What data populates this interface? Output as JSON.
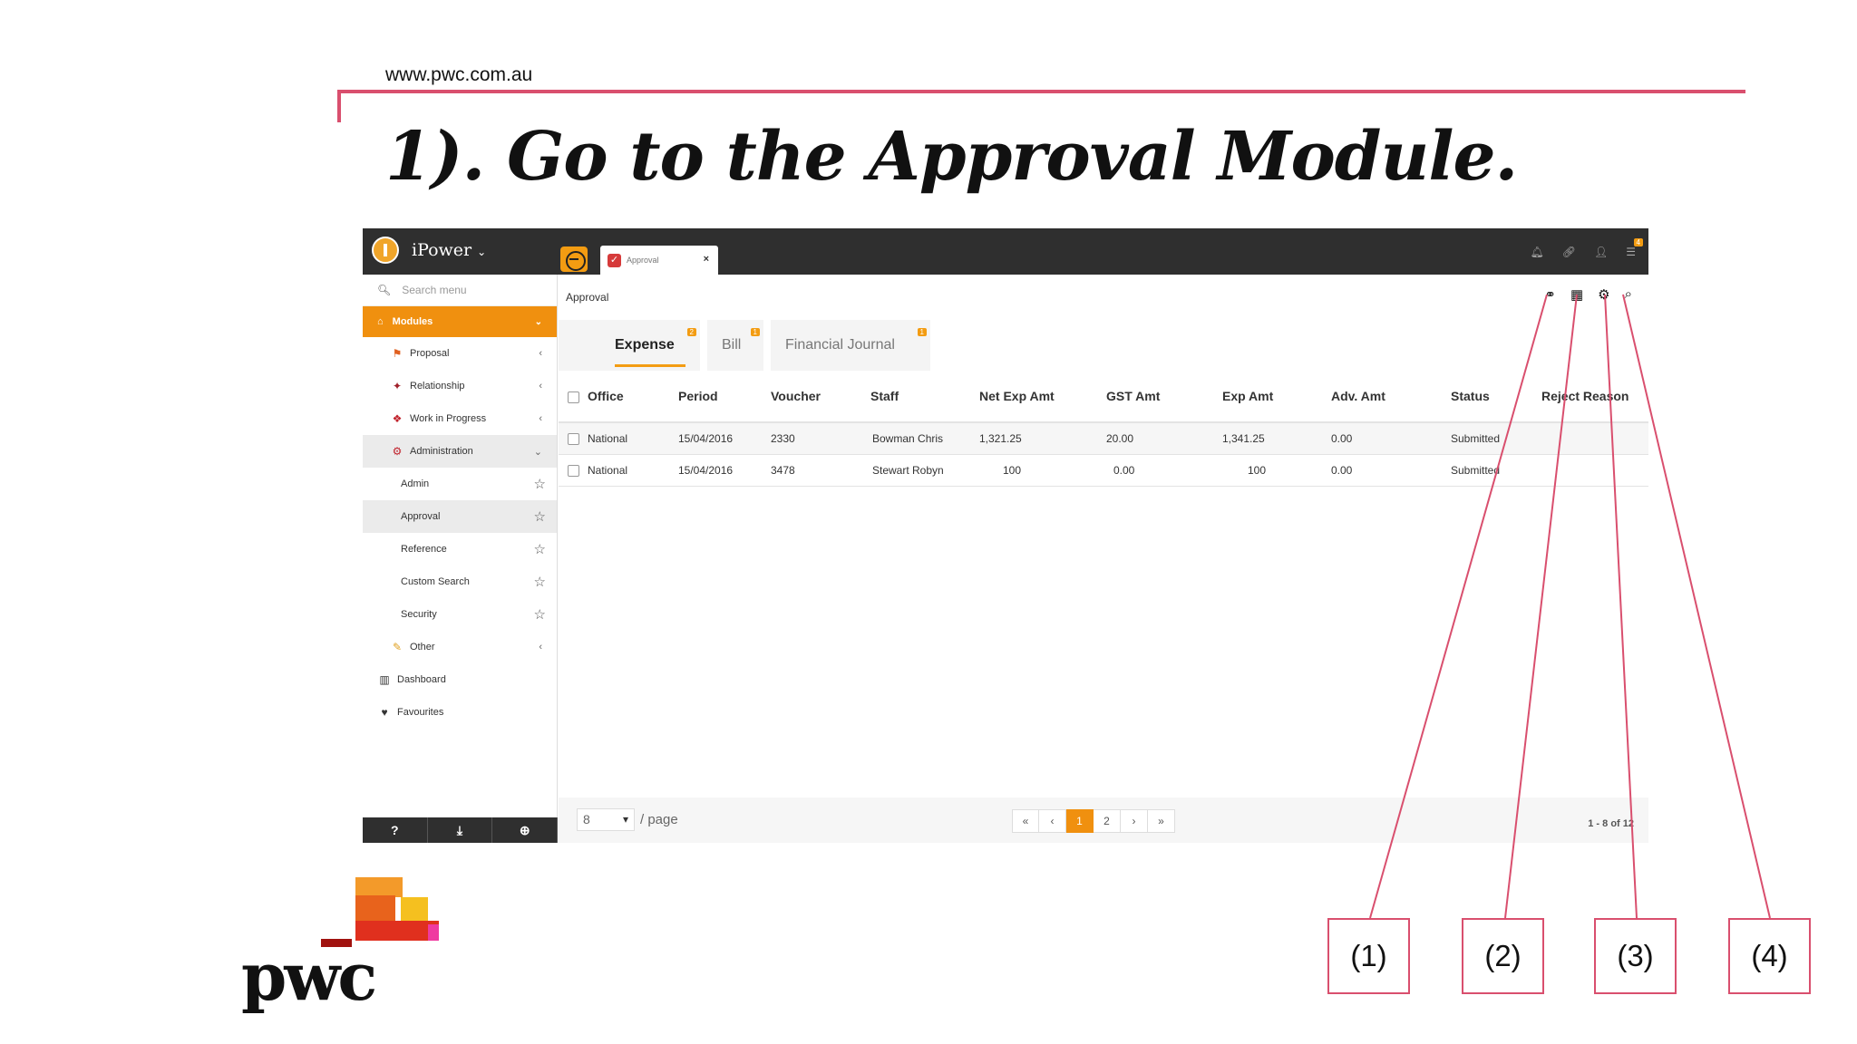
{
  "slide": {
    "url": "www.pwc.com.au",
    "title": "1). Go to the Approval Module.",
    "callouts": [
      "(1)",
      "(2)",
      "(3)",
      "(4)"
    ],
    "logo_text": "pwc",
    "accent_color": "#d94f6e"
  },
  "app": {
    "brand": "iPower",
    "open_tab": "Approval",
    "search_placeholder": "Search menu",
    "notification_count": "4",
    "sidebar": {
      "modules_label": "Modules",
      "items": [
        {
          "label": "Proposal"
        },
        {
          "label": "Relationship"
        },
        {
          "label": "Work in Progress"
        },
        {
          "label": "Administration"
        },
        {
          "label": "Admin"
        },
        {
          "label": "Approval"
        },
        {
          "label": "Reference"
        },
        {
          "label": "Custom Search"
        },
        {
          "label": "Security"
        },
        {
          "label": "Other"
        },
        {
          "label": "Dashboard"
        },
        {
          "label": "Favourites"
        }
      ],
      "footer_icons": [
        "help-icon",
        "download-icon",
        "zoom-icon"
      ]
    },
    "main": {
      "breadcrumb": "Approval",
      "tools": [
        "binoculars-icon",
        "grid-icon",
        "gear-icon",
        "search-icon"
      ],
      "tabs": [
        {
          "label": "Expense",
          "count": "2"
        },
        {
          "label": "Bill",
          "count": "1"
        },
        {
          "label": "Financial Journal",
          "count": "1"
        }
      ],
      "columns": [
        "Office",
        "Period",
        "Voucher",
        "Staff",
        "Net Exp Amt",
        "GST Amt",
        "Exp Amt",
        "Adv. Amt",
        "Status",
        "Reject Reason"
      ],
      "rows": [
        [
          "National",
          "15/04/2016",
          "2330",
          "Bowman Chris",
          "1,321.25",
          "20.00",
          "1,341.25",
          "0.00",
          "Submitted",
          ""
        ],
        [
          "National",
          "15/04/2016",
          "3478",
          "Stewart Robyn",
          "100",
          "0.00",
          "100",
          "0.00",
          "Submitted",
          ""
        ]
      ],
      "pager": {
        "per_page_value": "8",
        "per_page_label": "/ page",
        "buttons": [
          "«",
          "‹",
          "1",
          "2",
          "›",
          "»"
        ],
        "current_page": "1",
        "range": "1 - 8 of 12"
      }
    },
    "accent_color": "#f0900f"
  }
}
